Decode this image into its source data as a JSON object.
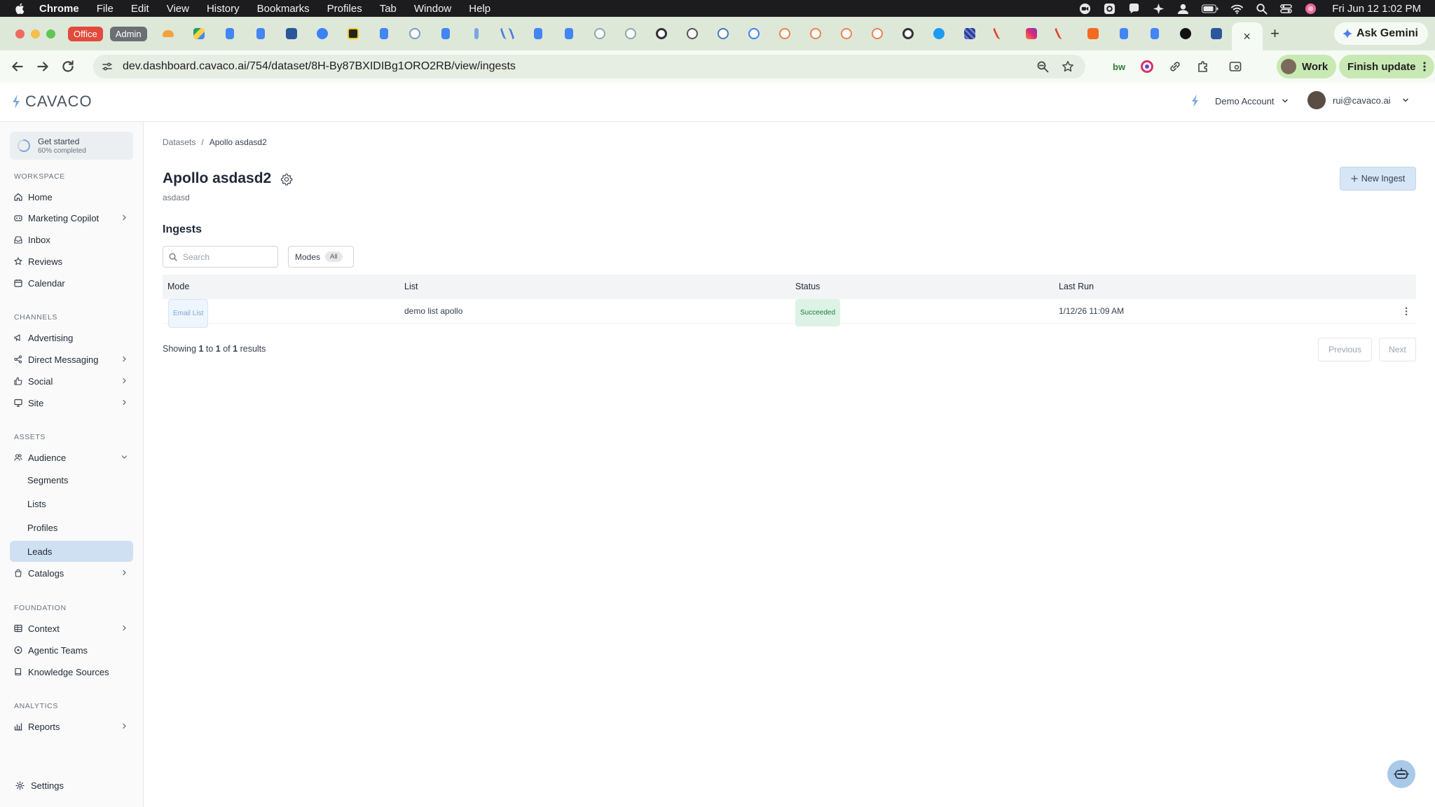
{
  "menubar": {
    "app": "Chrome",
    "items": [
      "File",
      "Edit",
      "View",
      "History",
      "Bookmarks",
      "Profiles",
      "Tab",
      "Window",
      "Help"
    ],
    "clock": "Fri Jun 12  1:02 PM"
  },
  "tabs": {
    "group_office": "Office",
    "group_admin": "Admin",
    "active_close": "×",
    "new_tab": "+",
    "ask_gemini": "Ask Gemini"
  },
  "toolbar": {
    "url": "dev.dashboard.cavaco.ai/754/dataset/8H-By87BXIDIBg1ORO2RB/view/ingests",
    "bw_label": "bw",
    "work_label": "Work",
    "finish_update_label": "Finish update"
  },
  "header": {
    "logo_text": "CAVACO",
    "account_label": "Demo Account",
    "user_email": "rui@cavaco.ai"
  },
  "sidebar": {
    "get_started": {
      "title": "Get started",
      "progress_text": "60% completed",
      "progress": 0.6
    },
    "sections": {
      "workspace": "WORKSPACE",
      "channels": "CHANNELS",
      "assets": "ASSETS",
      "foundation": "FOUNDATION",
      "analytics": "ANALYTICS"
    },
    "items": {
      "home": "Home",
      "marketing_copilot": "Marketing Copilot",
      "inbox": "Inbox",
      "reviews": "Reviews",
      "calendar": "Calendar",
      "advertising": "Advertising",
      "direct_messaging": "Direct Messaging",
      "social": "Social",
      "site": "Site",
      "audience": "Audience",
      "segments": "Segments",
      "lists": "Lists",
      "profiles": "Profiles",
      "leads": "Leads",
      "catalogs": "Catalogs",
      "context": "Context",
      "agentic_teams": "Agentic Teams",
      "knowledge_sources": "Knowledge Sources",
      "reports": "Reports",
      "settings": "Settings"
    }
  },
  "main": {
    "breadcrumb": [
      "Datasets",
      "/",
      "Apollo asdasd2"
    ],
    "title": "Apollo asdasd2",
    "subtitle": "asdasd",
    "new_ingest_label": "New Ingest",
    "section_title": "Ingests",
    "search_placeholder": "Search",
    "modes_label": "Modes",
    "modes_value": "All",
    "table": {
      "columns": [
        "Mode",
        "List",
        "Status",
        "Last Run"
      ],
      "rows": [
        {
          "mode": "Email List",
          "list": "demo list apollo",
          "status": "Succeeded",
          "last_run": "1/12/26 11:09 AM"
        }
      ]
    },
    "showing": {
      "prefix": "Showing",
      "from": "1",
      "to_word": "to",
      "to": "1",
      "of_word": "of",
      "total": "1",
      "suffix": "results"
    },
    "pagination": {
      "previous": "Previous",
      "next": "Next"
    }
  },
  "colors": {
    "accent": "#cfe0f3",
    "success": "#1f7a43",
    "chrome_frame": "#dde8d8"
  }
}
